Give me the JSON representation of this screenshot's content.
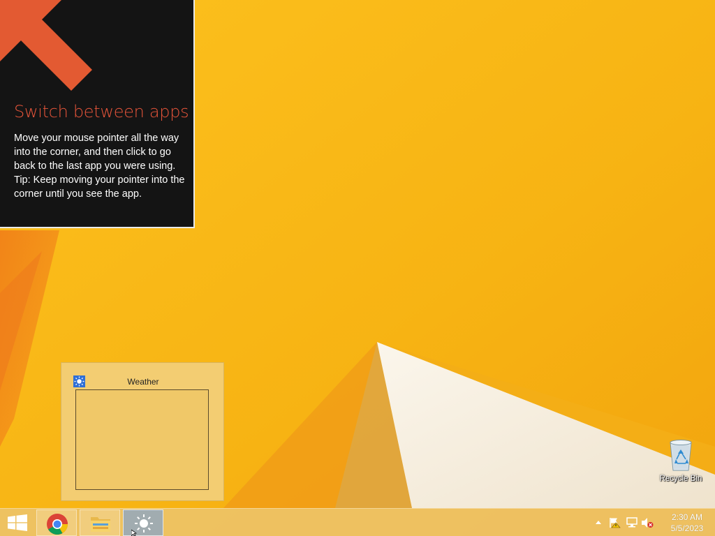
{
  "tip": {
    "title": "Switch between apps",
    "body": "Move your mouse pointer all the way into the corner, and then click to go back to the last app you were using.",
    "tip_text": "Tip: Keep moving your pointer into the corner until you see the app.",
    "arrow_icon": "arrow-up-left-icon"
  },
  "preview": {
    "title": "Weather",
    "icon": "weather-sun-icon"
  },
  "desktop_icons": [
    {
      "label": "Recycle Bin",
      "icon": "recycle-bin-icon"
    }
  ],
  "taskbar": {
    "start_icon": "windows-logo-icon",
    "apps": [
      {
        "name": "Google Chrome",
        "icon": "chrome-icon",
        "active": false
      },
      {
        "name": "File Explorer",
        "icon": "folder-icon",
        "active": false
      },
      {
        "name": "Weather",
        "icon": "weather-sun-icon",
        "active": true
      }
    ],
    "tray": {
      "icons": [
        "show-hidden-icons-arrow-icon",
        "action-center-flag-icon",
        "network-icon",
        "volume-muted-icon"
      ],
      "time": "2:30 AM",
      "date": "5/5/2023"
    }
  },
  "colors": {
    "accent_orange": "#e8553a",
    "tip_background": "#141414",
    "wallpaper_yellow": "#f6b512",
    "weather_blue": "#2f6fd6"
  }
}
